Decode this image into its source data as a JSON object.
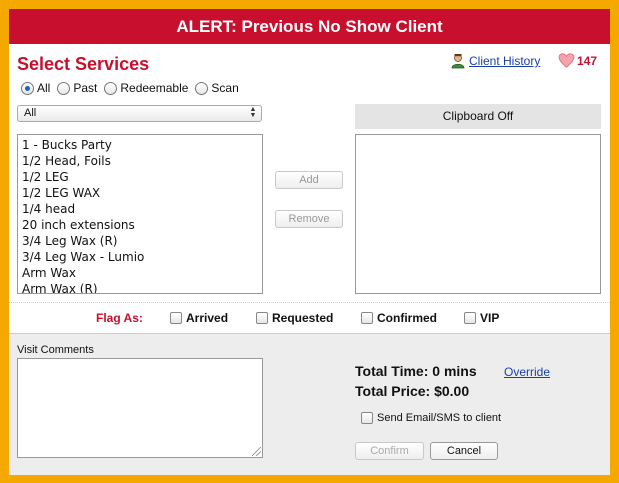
{
  "alert": {
    "text": "ALERT: Previous No Show Client"
  },
  "header": {
    "title": "Select Services",
    "client_history_label": "Client History",
    "heart_count": "147"
  },
  "filters": {
    "options": [
      "All",
      "Past",
      "Redeemable",
      "Scan"
    ],
    "selected": "All",
    "category_select_value": "All"
  },
  "services": [
    "1 - Bucks Party",
    "1/2 Head, Foils",
    "1/2 LEG",
    "1/2 LEG WAX",
    "1/4 head",
    "20 inch extensions",
    "3/4 Leg Wax (R)",
    "3/4 Leg Wax - Lumio",
    "Arm Wax",
    "Arm Wax (R)"
  ],
  "actions": {
    "add_label": "Add",
    "remove_label": "Remove"
  },
  "clipboard": {
    "header": "Clipboard Off"
  },
  "flags": {
    "label": "Flag As:",
    "options": [
      "Arrived",
      "Requested",
      "Confirmed",
      "VIP"
    ]
  },
  "comments": {
    "label": "Visit Comments",
    "value": ""
  },
  "totals": {
    "time": "Total Time: 0 mins",
    "override_label": "Override",
    "price": "Total Price: $0.00"
  },
  "send": {
    "label": "Send Email/SMS to client"
  },
  "footer": {
    "confirm_label": "Confirm",
    "cancel_label": "Cancel"
  },
  "colors": {
    "alert_red": "#c8102e",
    "frame_orange": "#f5a800",
    "link_blue": "#1a3fa8"
  }
}
